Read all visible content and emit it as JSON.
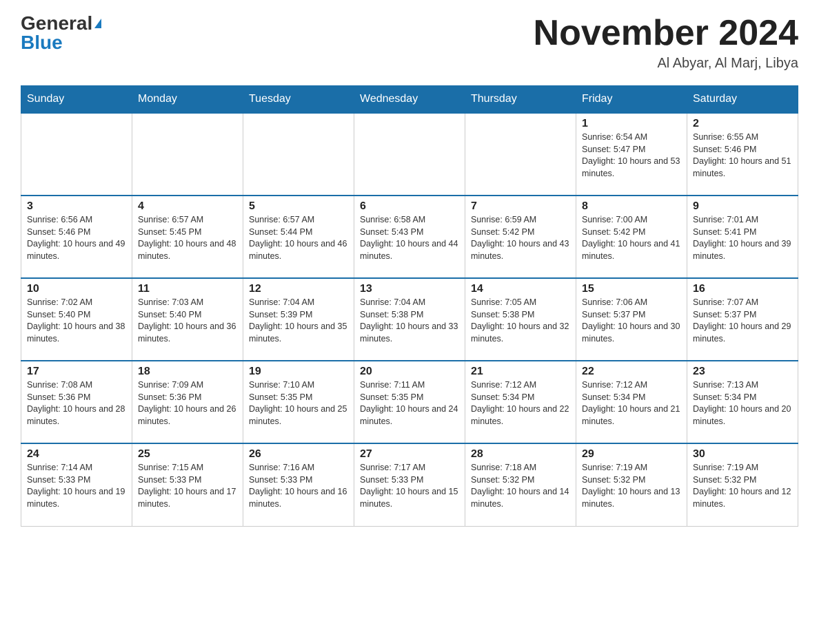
{
  "header": {
    "logo_general": "General",
    "logo_blue": "Blue",
    "month_title": "November 2024",
    "location": "Al Abyar, Al Marj, Libya"
  },
  "weekdays": [
    "Sunday",
    "Monday",
    "Tuesday",
    "Wednesday",
    "Thursday",
    "Friday",
    "Saturday"
  ],
  "weeks": [
    [
      {
        "day": "",
        "sunrise": "",
        "sunset": "",
        "daylight": ""
      },
      {
        "day": "",
        "sunrise": "",
        "sunset": "",
        "daylight": ""
      },
      {
        "day": "",
        "sunrise": "",
        "sunset": "",
        "daylight": ""
      },
      {
        "day": "",
        "sunrise": "",
        "sunset": "",
        "daylight": ""
      },
      {
        "day": "",
        "sunrise": "",
        "sunset": "",
        "daylight": ""
      },
      {
        "day": "1",
        "sunrise": "Sunrise: 6:54 AM",
        "sunset": "Sunset: 5:47 PM",
        "daylight": "Daylight: 10 hours and 53 minutes."
      },
      {
        "day": "2",
        "sunrise": "Sunrise: 6:55 AM",
        "sunset": "Sunset: 5:46 PM",
        "daylight": "Daylight: 10 hours and 51 minutes."
      }
    ],
    [
      {
        "day": "3",
        "sunrise": "Sunrise: 6:56 AM",
        "sunset": "Sunset: 5:46 PM",
        "daylight": "Daylight: 10 hours and 49 minutes."
      },
      {
        "day": "4",
        "sunrise": "Sunrise: 6:57 AM",
        "sunset": "Sunset: 5:45 PM",
        "daylight": "Daylight: 10 hours and 48 minutes."
      },
      {
        "day": "5",
        "sunrise": "Sunrise: 6:57 AM",
        "sunset": "Sunset: 5:44 PM",
        "daylight": "Daylight: 10 hours and 46 minutes."
      },
      {
        "day": "6",
        "sunrise": "Sunrise: 6:58 AM",
        "sunset": "Sunset: 5:43 PM",
        "daylight": "Daylight: 10 hours and 44 minutes."
      },
      {
        "day": "7",
        "sunrise": "Sunrise: 6:59 AM",
        "sunset": "Sunset: 5:42 PM",
        "daylight": "Daylight: 10 hours and 43 minutes."
      },
      {
        "day": "8",
        "sunrise": "Sunrise: 7:00 AM",
        "sunset": "Sunset: 5:42 PM",
        "daylight": "Daylight: 10 hours and 41 minutes."
      },
      {
        "day": "9",
        "sunrise": "Sunrise: 7:01 AM",
        "sunset": "Sunset: 5:41 PM",
        "daylight": "Daylight: 10 hours and 39 minutes."
      }
    ],
    [
      {
        "day": "10",
        "sunrise": "Sunrise: 7:02 AM",
        "sunset": "Sunset: 5:40 PM",
        "daylight": "Daylight: 10 hours and 38 minutes."
      },
      {
        "day": "11",
        "sunrise": "Sunrise: 7:03 AM",
        "sunset": "Sunset: 5:40 PM",
        "daylight": "Daylight: 10 hours and 36 minutes."
      },
      {
        "day": "12",
        "sunrise": "Sunrise: 7:04 AM",
        "sunset": "Sunset: 5:39 PM",
        "daylight": "Daylight: 10 hours and 35 minutes."
      },
      {
        "day": "13",
        "sunrise": "Sunrise: 7:04 AM",
        "sunset": "Sunset: 5:38 PM",
        "daylight": "Daylight: 10 hours and 33 minutes."
      },
      {
        "day": "14",
        "sunrise": "Sunrise: 7:05 AM",
        "sunset": "Sunset: 5:38 PM",
        "daylight": "Daylight: 10 hours and 32 minutes."
      },
      {
        "day": "15",
        "sunrise": "Sunrise: 7:06 AM",
        "sunset": "Sunset: 5:37 PM",
        "daylight": "Daylight: 10 hours and 30 minutes."
      },
      {
        "day": "16",
        "sunrise": "Sunrise: 7:07 AM",
        "sunset": "Sunset: 5:37 PM",
        "daylight": "Daylight: 10 hours and 29 minutes."
      }
    ],
    [
      {
        "day": "17",
        "sunrise": "Sunrise: 7:08 AM",
        "sunset": "Sunset: 5:36 PM",
        "daylight": "Daylight: 10 hours and 28 minutes."
      },
      {
        "day": "18",
        "sunrise": "Sunrise: 7:09 AM",
        "sunset": "Sunset: 5:36 PM",
        "daylight": "Daylight: 10 hours and 26 minutes."
      },
      {
        "day": "19",
        "sunrise": "Sunrise: 7:10 AM",
        "sunset": "Sunset: 5:35 PM",
        "daylight": "Daylight: 10 hours and 25 minutes."
      },
      {
        "day": "20",
        "sunrise": "Sunrise: 7:11 AM",
        "sunset": "Sunset: 5:35 PM",
        "daylight": "Daylight: 10 hours and 24 minutes."
      },
      {
        "day": "21",
        "sunrise": "Sunrise: 7:12 AM",
        "sunset": "Sunset: 5:34 PM",
        "daylight": "Daylight: 10 hours and 22 minutes."
      },
      {
        "day": "22",
        "sunrise": "Sunrise: 7:12 AM",
        "sunset": "Sunset: 5:34 PM",
        "daylight": "Daylight: 10 hours and 21 minutes."
      },
      {
        "day": "23",
        "sunrise": "Sunrise: 7:13 AM",
        "sunset": "Sunset: 5:34 PM",
        "daylight": "Daylight: 10 hours and 20 minutes."
      }
    ],
    [
      {
        "day": "24",
        "sunrise": "Sunrise: 7:14 AM",
        "sunset": "Sunset: 5:33 PM",
        "daylight": "Daylight: 10 hours and 19 minutes."
      },
      {
        "day": "25",
        "sunrise": "Sunrise: 7:15 AM",
        "sunset": "Sunset: 5:33 PM",
        "daylight": "Daylight: 10 hours and 17 minutes."
      },
      {
        "day": "26",
        "sunrise": "Sunrise: 7:16 AM",
        "sunset": "Sunset: 5:33 PM",
        "daylight": "Daylight: 10 hours and 16 minutes."
      },
      {
        "day": "27",
        "sunrise": "Sunrise: 7:17 AM",
        "sunset": "Sunset: 5:33 PM",
        "daylight": "Daylight: 10 hours and 15 minutes."
      },
      {
        "day": "28",
        "sunrise": "Sunrise: 7:18 AM",
        "sunset": "Sunset: 5:32 PM",
        "daylight": "Daylight: 10 hours and 14 minutes."
      },
      {
        "day": "29",
        "sunrise": "Sunrise: 7:19 AM",
        "sunset": "Sunset: 5:32 PM",
        "daylight": "Daylight: 10 hours and 13 minutes."
      },
      {
        "day": "30",
        "sunrise": "Sunrise: 7:19 AM",
        "sunset": "Sunset: 5:32 PM",
        "daylight": "Daylight: 10 hours and 12 minutes."
      }
    ]
  ]
}
